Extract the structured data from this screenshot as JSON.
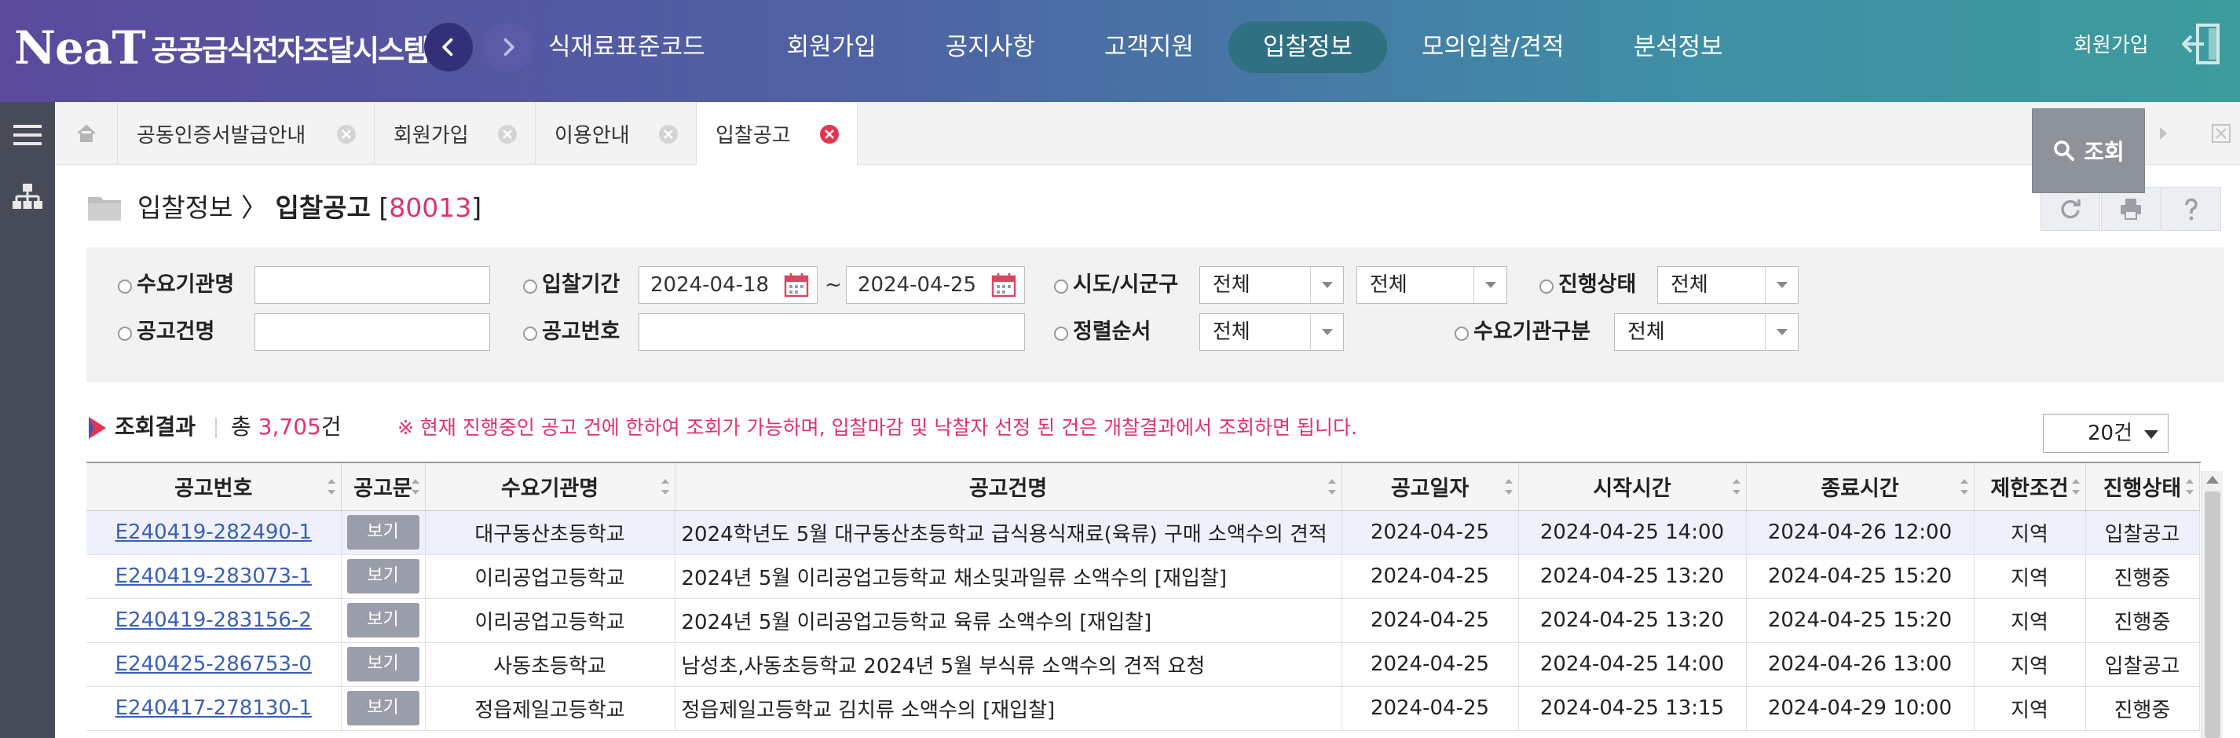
{
  "header": {
    "logo_text": "NeaT",
    "system_name": "공공급식전자조달시스템",
    "menu": [
      "식재료표준코드",
      "회원가입",
      "공지사항",
      "고객지원",
      "입찰정보",
      "모의입찰/견적",
      "분석정보"
    ],
    "active_menu_index": 4,
    "join_link": "회원가입"
  },
  "tabs": [
    {
      "label": "공동인증서발급안내",
      "active": false
    },
    {
      "label": "회원가입",
      "active": false
    },
    {
      "label": "이용안내",
      "active": false
    },
    {
      "label": "입찰공고",
      "active": true
    }
  ],
  "breadcrumb": {
    "parent": "입찰정보",
    "current": "입찰공고",
    "code": "80013"
  },
  "search": {
    "demand_agency_label": "수요기관명",
    "demand_agency_value": "",
    "bid_period_label": "입찰기간",
    "bid_from": "2024-04-18",
    "bid_to": "2024-04-25",
    "tilde": "~",
    "region_label": "시도/시군구",
    "region_sido": "전체",
    "region_sigungu": "전체",
    "status_label": "진행상태",
    "status_value": "전체",
    "notice_name_label": "공고건명",
    "notice_name_value": "",
    "notice_no_label": "공고번호",
    "notice_no_value": "",
    "sort_label": "정렬순서",
    "sort_value": "전체",
    "agency_type_label": "수요기관구분",
    "agency_type_value": "전체",
    "search_button": "조회"
  },
  "results": {
    "title": "조회결과",
    "count_prefix": "총 ",
    "count": "3,705",
    "count_suffix": "건",
    "note": "※ 현재 진행중인 공고 건에 한하여 조회가 가능하며, 입찰마감 및 낙찰자 선정 된 건은 개찰결과에서 조회하면 됩니다.",
    "page_size": "20건"
  },
  "table": {
    "columns": [
      "공고번호",
      "공고문",
      "수요기관명",
      "공고건명",
      "공고일자",
      "시작시간",
      "종료시간",
      "제한조건",
      "진행상태"
    ],
    "view_label": "보기",
    "rows": [
      {
        "no": "E240419-282490-1",
        "agency": "대구동산초등학교",
        "title": "2024학년도 5월 대구동산초등학교 급식용식재료(육류) 구매 소액수의 견적",
        "date": "2024-04-25",
        "start": "2024-04-25 14:00",
        "end": "2024-04-26 12:00",
        "limit": "지역",
        "status": "입찰공고"
      },
      {
        "no": "E240419-283073-1",
        "agency": "이리공업고등학교",
        "title": "2024년 5월 이리공업고등학교 채소및과일류 소액수의 [재입찰]",
        "date": "2024-04-25",
        "start": "2024-04-25 13:20",
        "end": "2024-04-25 15:20",
        "limit": "지역",
        "status": "진행중"
      },
      {
        "no": "E240419-283156-2",
        "agency": "이리공업고등학교",
        "title": "2024년 5월 이리공업고등학교 육류 소액수의  [재입찰]",
        "date": "2024-04-25",
        "start": "2024-04-25 13:20",
        "end": "2024-04-25 15:20",
        "limit": "지역",
        "status": "진행중"
      },
      {
        "no": "E240425-286753-0",
        "agency": "사동초등학교",
        "title": "남성초,사동초등학교 2024년 5월 부식류 소액수의 견적 요청",
        "date": "2024-04-25",
        "start": "2024-04-25 14:00",
        "end": "2024-04-26 13:00",
        "limit": "지역",
        "status": "입찰공고"
      },
      {
        "no": "E240417-278130-1",
        "agency": "정읍제일고등학교",
        "title": "정읍제일고등학교 김치류 소액수의  [재입찰]",
        "date": "2024-04-25",
        "start": "2024-04-25 13:15",
        "end": "2024-04-29 10:00",
        "limit": "지역",
        "status": "진행중"
      }
    ]
  },
  "colors": {
    "accent_pink": "#e0336a",
    "link_blue": "#3a5fb8",
    "sidebar": "#474a57",
    "active_menu": "#2f7082"
  },
  "icons": [
    "chevron-left-icon",
    "chevron-right-icon",
    "logout-icon",
    "hamburger-menu-icon",
    "sitemap-icon",
    "home-icon",
    "close-icon",
    "folder-icon",
    "refresh-icon",
    "print-icon",
    "help-icon",
    "calendar-icon",
    "search-icon",
    "result-arrow-icon"
  ]
}
